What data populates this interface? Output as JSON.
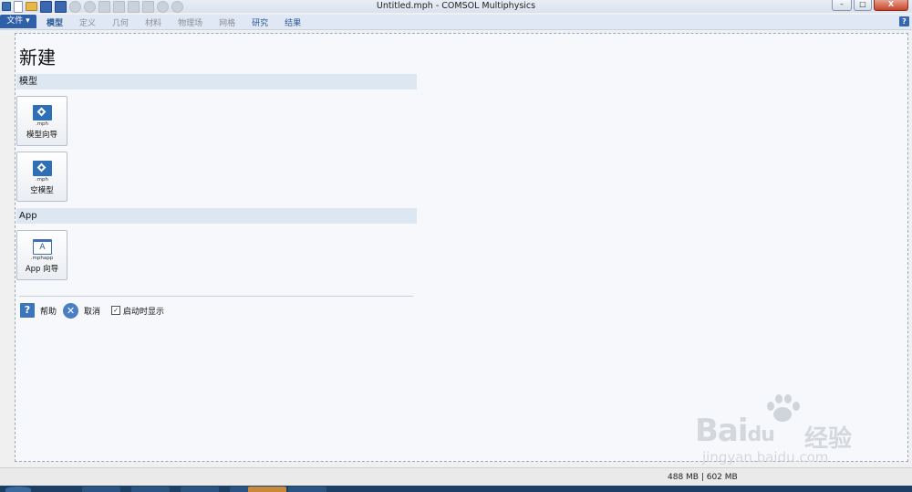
{
  "window": {
    "title": "Untitled.mph - COMSOL Multiphysics",
    "controls": {
      "minimize": "–",
      "maximize": "□",
      "close": "X"
    }
  },
  "quick_access": [
    {
      "icon": "app-icon"
    },
    {
      "icon": "new-file-icon"
    },
    {
      "icon": "open-folder-icon"
    },
    {
      "icon": "save-icon"
    },
    {
      "icon": "save-as-icon"
    },
    {
      "icon": "undo-icon"
    },
    {
      "icon": "redo-icon"
    },
    {
      "icon": "copy-icon"
    },
    {
      "icon": "paste-icon"
    },
    {
      "icon": "duplicate-icon"
    },
    {
      "icon": "delete-icon"
    },
    {
      "icon": "compact-icon"
    },
    {
      "icon": "settings-icon"
    }
  ],
  "ribbon": {
    "file_label": "文件 ▾",
    "tabs": [
      "模型",
      "定义",
      "几何",
      "材料",
      "物理场",
      "网格",
      "研究",
      "结果"
    ],
    "help": "?"
  },
  "new_panel": {
    "title": "新建",
    "sections": [
      {
        "label": "模型",
        "tiles": [
          {
            "ext": ".mph",
            "label": "模型向导",
            "icon": "model-wizard-icon"
          },
          {
            "ext": ".mph",
            "label": "空模型",
            "icon": "blank-model-icon"
          }
        ]
      },
      {
        "label": "App",
        "tiles": [
          {
            "ext": ".mphapp",
            "label": "App 向导",
            "icon": "app-wizard-icon",
            "glyph": "A"
          }
        ]
      }
    ],
    "footer": {
      "help_glyph": "?",
      "help_label": "帮助",
      "cancel_glyph": "✕",
      "cancel_label": "取消",
      "show_on_startup_checked": true,
      "show_on_startup_label": "启动时显示"
    }
  },
  "status_bar": {
    "memory": "488 MB | 602 MB"
  },
  "watermark": {
    "brand": "Bai",
    "brand_tail": "du",
    "brand_cn": "经验",
    "url": "jingyan.baidu.com"
  }
}
